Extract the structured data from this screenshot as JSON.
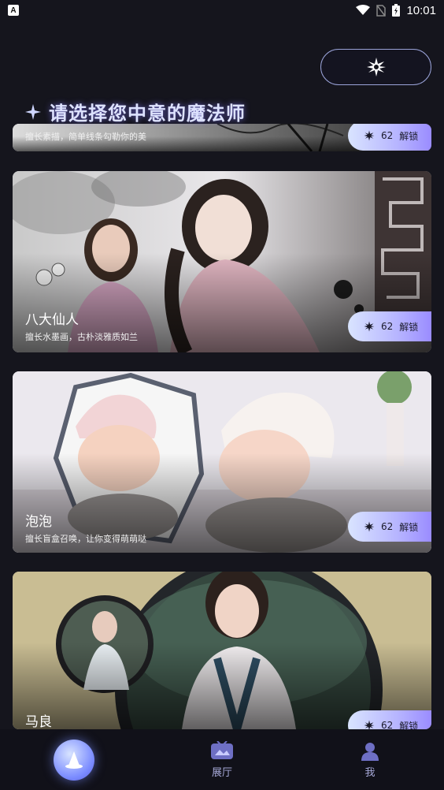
{
  "status_bar": {
    "app_letter": "A",
    "time": "10:01"
  },
  "header": {
    "title": "请选择您中意的魔法师"
  },
  "cards": [
    {
      "name": "",
      "desc": "擅长素描，简单线条勾勒你的美",
      "unlock_count": "62",
      "unlock_label": "解锁"
    },
    {
      "name": "八大仙人",
      "desc": "擅长水墨画，古朴淡雅质如兰",
      "unlock_count": "62",
      "unlock_label": "解锁"
    },
    {
      "name": "泡泡",
      "desc": "擅长盲盒召唤，让你变得萌萌哒",
      "unlock_count": "62",
      "unlock_label": "解锁"
    },
    {
      "name": "马良",
      "desc": "",
      "unlock_count": "62",
      "unlock_label": "解锁"
    }
  ],
  "nav": {
    "items": [
      {
        "label": "",
        "icon": "wizard-hat-icon"
      },
      {
        "label": "展厅",
        "icon": "gallery-icon"
      },
      {
        "label": "我",
        "icon": "user-icon"
      }
    ]
  },
  "colors": {
    "accent": "#9a8cff",
    "nav_label": "#a7a9d8",
    "background": "#15151d"
  }
}
